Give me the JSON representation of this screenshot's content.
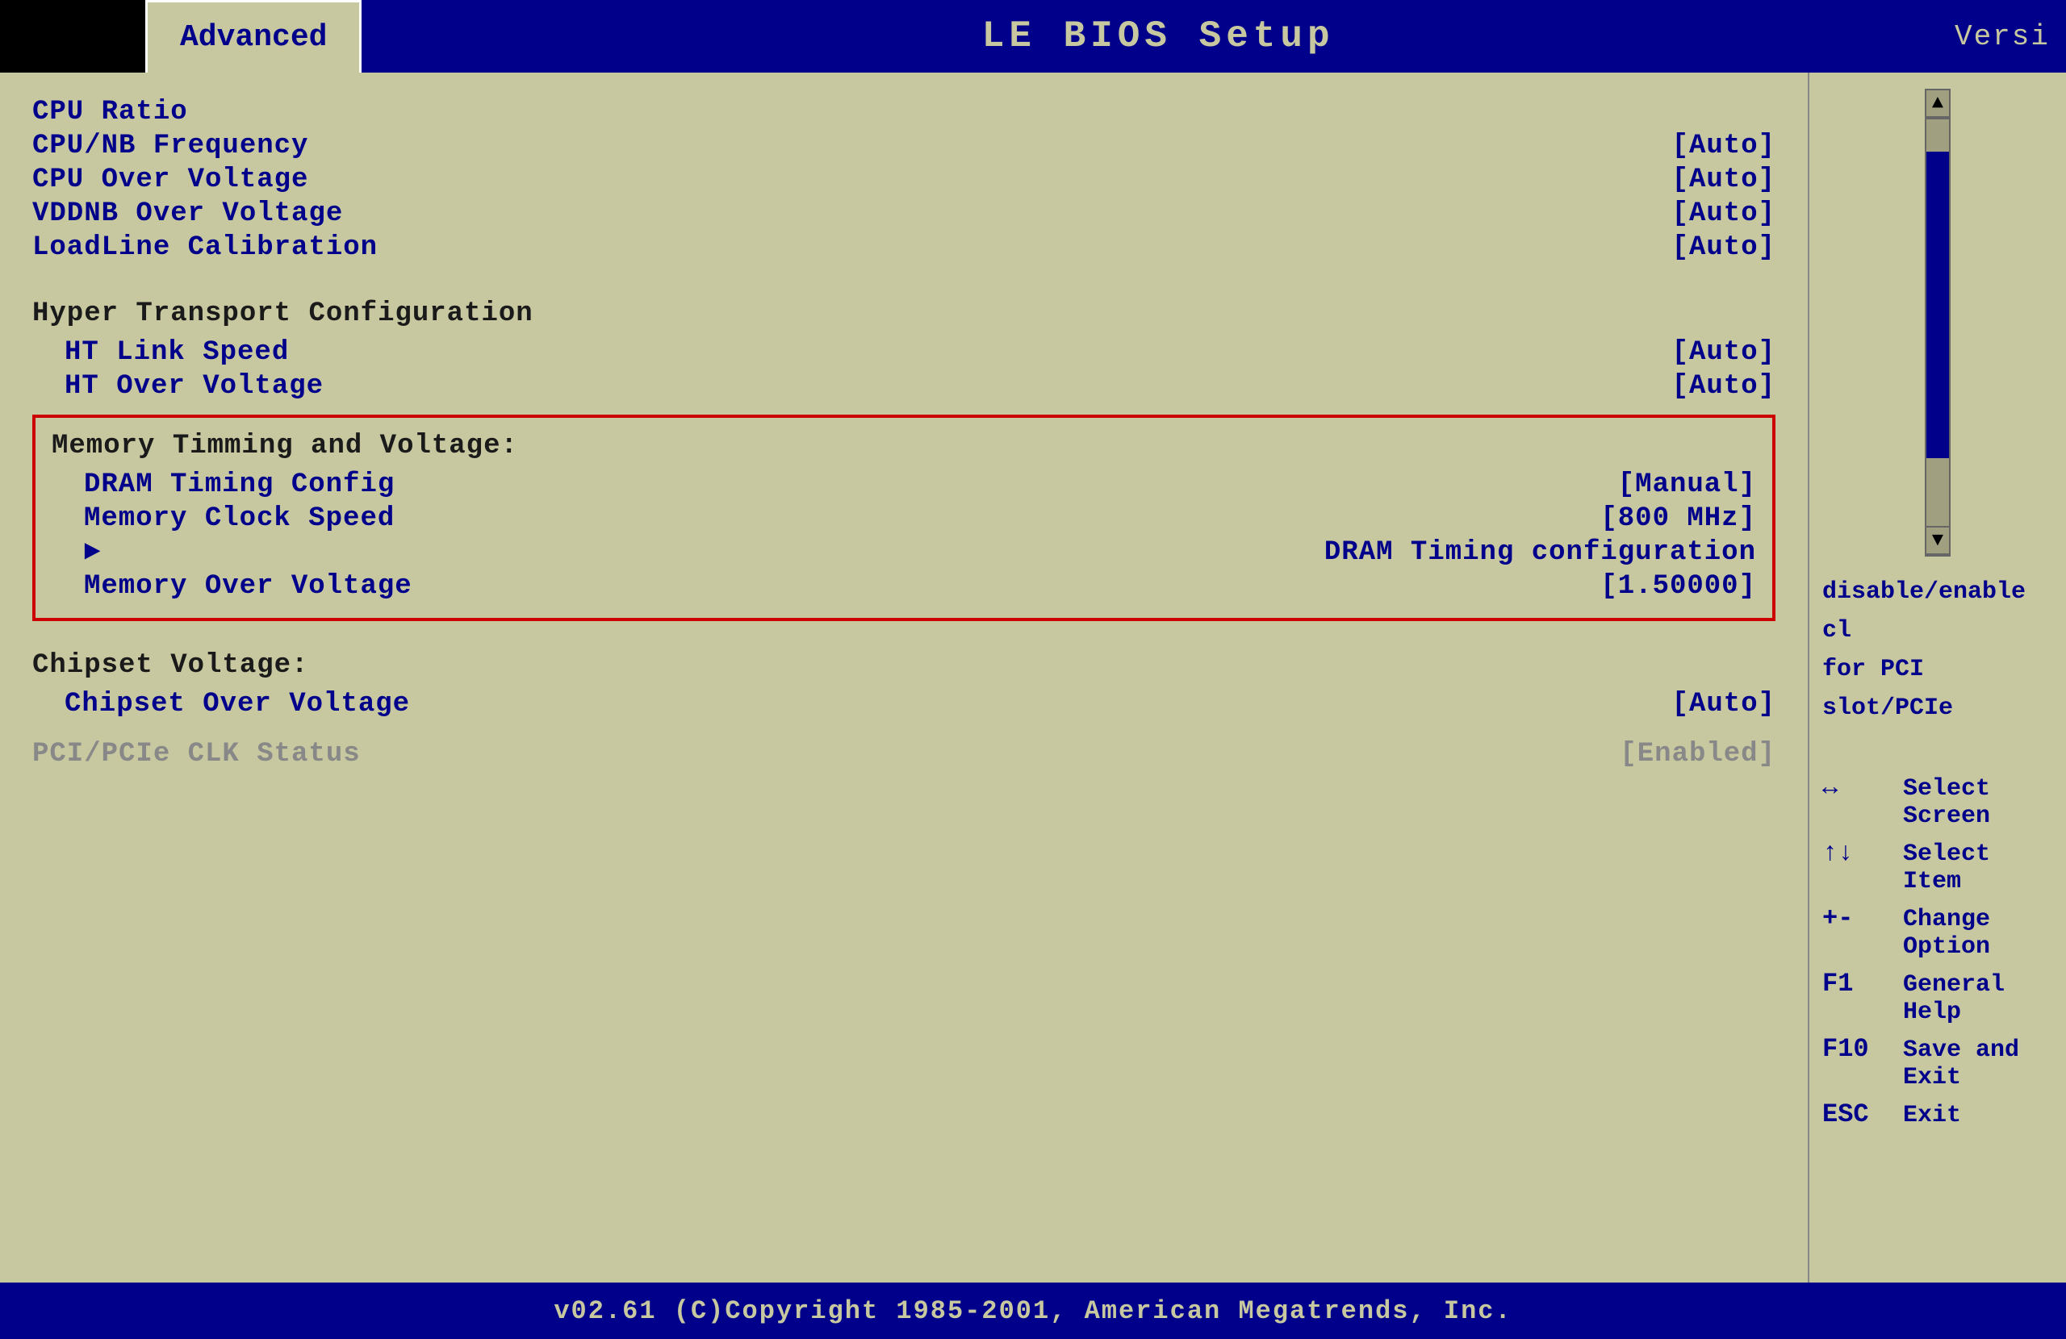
{
  "header": {
    "tab_label": "Advanced",
    "title": "LE BIOS  Setup",
    "version_label": "Versi"
  },
  "menu": {
    "cpu_ratio_label": "CPU Ratio",
    "cpu_nb_freq_label": "CPU/NB Frequency",
    "cpu_nb_freq_value": "[Auto]",
    "cpu_over_voltage_label": "CPU Over Voltage",
    "cpu_over_voltage_value": "[Auto]",
    "vddnb_over_voltage_label": "VDDNB Over Voltage",
    "vddnb_over_voltage_value": "[Auto]",
    "loadline_calibration_label": "LoadLine Calibration",
    "loadline_calibration_value": "[Auto]",
    "ht_config_label": "Hyper Transport Configuration",
    "ht_link_speed_label": "HT Link Speed",
    "ht_over_voltage_label": "HT Over Voltage",
    "ht_link_speed_value": "[Auto]",
    "ht_over_voltage_value": "[Auto]",
    "memory_section_label": "Memory Timming and Voltage:",
    "dram_timing_config_label": "DRAM Timing Config",
    "dram_timing_config_value": "[Manual]",
    "memory_clock_speed_label": "Memory Clock Speed",
    "memory_clock_speed_value": "[800 MHz]",
    "dram_timing_conf_sub_label": "DRAM Timing configuration",
    "memory_over_voltage_label": "Memory Over Voltage",
    "memory_over_voltage_value": "[1.50000]",
    "chipset_voltage_label": "Chipset Voltage:",
    "chipset_over_voltage_label": "Chipset Over Voltage",
    "chipset_over_voltage_value": "[Auto]",
    "pci_clk_label": "PCI/PCIe CLK Status",
    "pci_clk_value": "[Enabled]"
  },
  "help": {
    "line1": "disable/enable cl",
    "line2": "for PCI slot/PCIe"
  },
  "legend": {
    "arrow_lr_key": "↔",
    "arrow_lr_desc": "Select Screen",
    "arrow_ud_key": "↑↓",
    "arrow_ud_desc": "Select Item",
    "plus_minus_key": "+-",
    "plus_minus_desc": "Change Option",
    "f1_key": "F1",
    "f1_desc": "General Help",
    "f10_key": "F10",
    "f10_desc": "Save and Exit",
    "esc_key": "ESC",
    "esc_desc": "Exit"
  },
  "footer": {
    "text": "v02.61  (C)Copyright 1985-2001, American Megatrends, Inc."
  }
}
